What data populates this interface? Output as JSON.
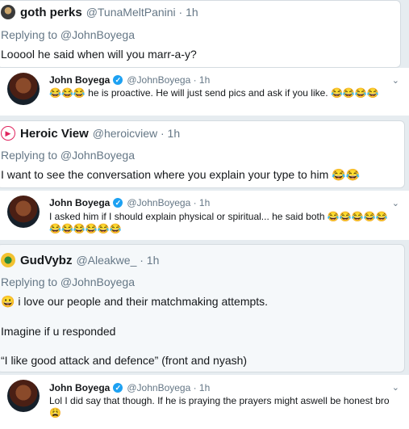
{
  "quote1": {
    "name": "goth perks",
    "handle": "@TunaMeltPanini · 1h",
    "replying": "Replying to @JohnBoyega",
    "text": "Looool he said when will you marr-a-y?"
  },
  "tweet1": {
    "name": "John Boyega",
    "handle": "@JohnBoyega · 1h",
    "text": "😂😂😂 he is proactive. He will just send pics and ask if you like. 😂😂😂😂"
  },
  "quote2": {
    "name": "Heroic View",
    "handle": "@heroicview · 1h",
    "replying": "Replying to @JohnBoyega",
    "text": "I want to see the conversation where you explain your type to him 😂😂"
  },
  "tweet2": {
    "name": "John Boyega",
    "handle": "@JohnBoyega · 1h",
    "text": "I asked him if I should explain physical or spiritual... he said both 😂😂😂😂😂😂😂😂😂😂😂"
  },
  "quote3": {
    "name": "GudVybz",
    "handle": "@Aleakwe_ · 1h",
    "replying": "Replying to @JohnBoyega",
    "line1": "😀 i love our people and their matchmaking attempts.",
    "line2": "Imagine if u responded",
    "line3": "“I like good attack and defence”  (front and nyash)"
  },
  "tweet3": {
    "name": "John Boyega",
    "handle": "@JohnBoyega · 1h",
    "text": "Lol I did say that though. If he is praying the prayers might aswell be honest bro 😩"
  },
  "icons": {
    "verified": "verified-badge-icon",
    "chevron": "chevron-down-icon"
  },
  "colors": {
    "link_blue": "#1da1f2",
    "muted": "#657786",
    "background": "#e6ecf0"
  }
}
